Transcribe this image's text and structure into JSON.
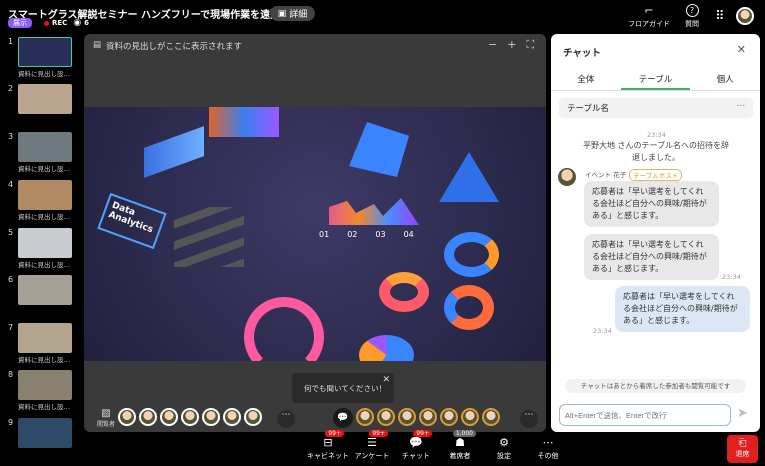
{
  "header": {
    "title": "スマートグラス解説セミナー ハンズフリーで現場作業を遠隔支援！",
    "detail_label": "詳細",
    "status_badge": "展示",
    "rec_label": "REC",
    "viewer_count": "6",
    "floor_guide": "フロアガイド",
    "question": "質問"
  },
  "slides": [
    {
      "num": "1",
      "caption": "資料に見出し設…",
      "color": "#2a2f5a"
    },
    {
      "num": "2",
      "caption": "",
      "color": "#b9a58d"
    },
    {
      "num": "3",
      "caption": "資料に見出し設…",
      "color": "#6e7a80"
    },
    {
      "num": "4",
      "caption": "資料に見出し設…",
      "color": "#b08a62"
    },
    {
      "num": "5",
      "caption": "資料に見出し設…",
      "color": "#c9ccd0"
    },
    {
      "num": "6",
      "caption": "",
      "color": "#a7a096"
    },
    {
      "num": "7",
      "caption": "資料に見出し設…",
      "color": "#b5a58e"
    },
    {
      "num": "8",
      "caption": "資料に見出し設…",
      "color": "#8a8070"
    },
    {
      "num": "9",
      "caption": "",
      "color": "#2d4a66"
    }
  ],
  "stage": {
    "heading": "資料の見出しがここに表示されます",
    "slide_text": "Data Analytics",
    "chart_labels": [
      "01",
      "02",
      "03",
      "04"
    ],
    "viewer_label": "閲覧者",
    "tooltip": "何でも聞いてください！"
  },
  "toolbar": [
    {
      "label": "キャビネット",
      "count": "99+"
    },
    {
      "label": "アンケート",
      "count": "99+"
    },
    {
      "label": "チャット",
      "count": "99+"
    },
    {
      "label": "着席者",
      "count": "1,000"
    },
    {
      "label": "設定",
      "count": ""
    },
    {
      "label": "その他",
      "count": ""
    }
  ],
  "leave_label": "退席",
  "chat": {
    "title": "チャット",
    "tabs": [
      "全体",
      "テーブル",
      "個人"
    ],
    "active_tab": "テーブル",
    "table_name": "テーブル名",
    "system_time": "23:34",
    "system_msg": "平野大地 さんのテーブル名への招待を辞退しました。",
    "sender": "イベント 花子",
    "sender_badge": "テーブルホスト",
    "messages": [
      {
        "text": "応募者は「早い選考をしてくれる会社ほど自分への興味/期待がある」と感じます。",
        "time": ""
      },
      {
        "text": "応募者は「早い選考をしてくれる会社ほど自分への興味/期待がある」と感じます。",
        "time": "23:34"
      },
      {
        "text": "応募者は「早い選考をしてくれる会社ほど自分への興味/期待がある」と感じます。",
        "time": "23:34"
      }
    ],
    "notice": "チャットはあとから着席した参加者も閲覧可能です",
    "input_placeholder": "Alt+Enterで送信、Enterで改行"
  }
}
